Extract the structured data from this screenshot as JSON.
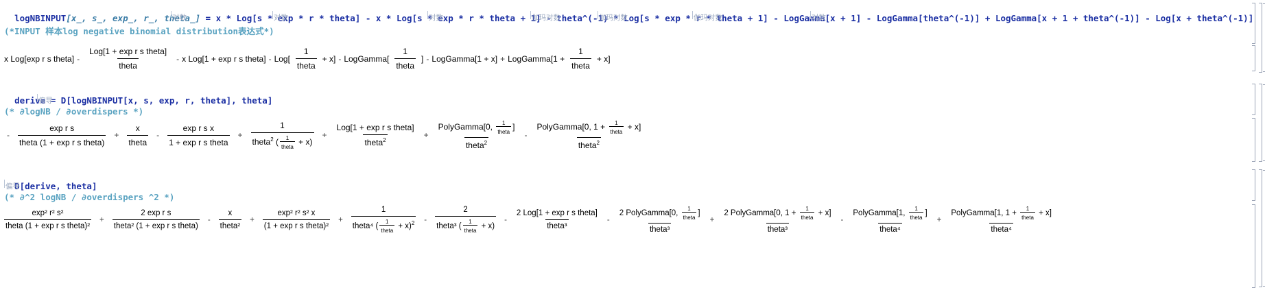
{
  "input1": {
    "func": "logNBINPUT",
    "args": "[x_, s_, exp_, r_, theta_]",
    "rhs": " = x * Log[s * exp * r * theta] - x * Log[s * exp * r * theta + 1] - theta^(-1) * Log[s * exp * r * theta + 1] - LogGamma[x + 1] - LogGamma[theta^(-1)] + LogGamma[x + 1 + theta^(-1)] - Log[x + theta^(-1)]",
    "glosses": [
      "对数",
      "对数",
      "对数",
      "伽玛对数",
      "伽玛对数",
      "伽玛对数",
      "对数"
    ]
  },
  "comment1": "(*INPUT 样本log negative binomial distribution表达式*)",
  "output1": {
    "t1": "x Log[exp r s theta]",
    "f1_num": "Log[1 + exp r s theta]",
    "f1_den": "theta",
    "t2": "x Log[1 + exp r s theta]",
    "t3_pre": "Log[",
    "t3_num": "1",
    "t3_den": "theta",
    "t3_post": " + x]",
    "t4_pre": "LogGamma[",
    "t4_num": "1",
    "t4_den": "theta",
    "t4_post": "]",
    "t5": "LogGamma[1 + x]",
    "t6_pre": "LogGamma[1 +",
    "t6_num": "1",
    "t6_den": "theta",
    "t6_post": "+ x]"
  },
  "input2": {
    "lhs": "derive",
    "rhs": " = D[logNBINPUT[x, s, exp, r, theta], theta]",
    "gloss": "偏导"
  },
  "comment2": "(* ∂logNB / ∂overdispers *)",
  "output2": {
    "a_num": "exp r s",
    "a_den": "theta (1 + exp r s theta)",
    "b_num": "x",
    "b_den": "theta",
    "c_num": "exp r s x",
    "c_den": "1 + exp r s theta",
    "d_num": "1",
    "d_den": "theta",
    "e_num": "Log[1 + exp r s theta]",
    "e_den": "theta",
    "f_num": "PolyGamma[0,",
    "f_den": "theta",
    "g_num": "PolyGamma[0, 1 +",
    "g_den": "theta"
  },
  "input3": {
    "text": "D[derive, theta]",
    "gloss": "偏导"
  },
  "comment3": "(* ∂^2 logNB / ∂overdispers ^2 *)",
  "output3": {
    "a_num": "exp² r² s²",
    "a_den": "theta (1 + exp r s theta)²",
    "b_num": "2 exp r s",
    "b_den": "theta² (1 + exp r s theta)",
    "c_num": "x",
    "c_den": "theta²",
    "d_num": "exp² r² s² x",
    "d_den": "(1 + exp r s theta)²",
    "e_num": "1",
    "e_den": "theta⁴",
    "f_num": "2",
    "f_den": "theta³",
    "g_num": "2 Log[1 + exp r s theta]",
    "g_den": "theta³",
    "h_num": "2 PolyGamma[0,",
    "h_den": "theta³",
    "i_num": "2 PolyGamma[0, 1 +",
    "i_den": "theta³",
    "j_num": "PolyGamma[1,",
    "j_den": "theta⁴",
    "k_num": "PolyGamma[1, 1 +",
    "k_den": "theta⁴"
  },
  "common": {
    "one": "1",
    "theta": "theta",
    "plusx": "+ x]",
    "rb": "]"
  }
}
